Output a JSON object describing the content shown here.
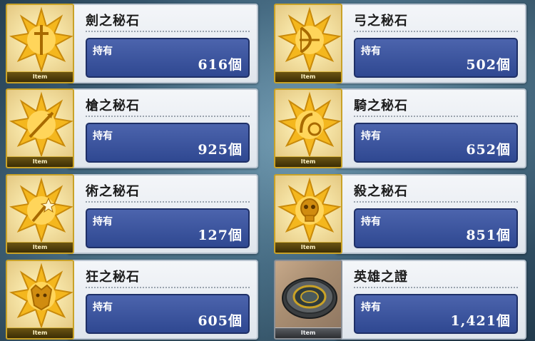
{
  "items": [
    {
      "name": "劍之秘石",
      "own_label": "持有",
      "count": "616個",
      "tag": "Item",
      "icon": "saber-star-icon",
      "kind": "star"
    },
    {
      "name": "弓之秘石",
      "own_label": "持有",
      "count": "502個",
      "tag": "Item",
      "icon": "archer-star-icon",
      "kind": "star"
    },
    {
      "name": "槍之秘石",
      "own_label": "持有",
      "count": "925個",
      "tag": "Item",
      "icon": "lancer-star-icon",
      "kind": "star"
    },
    {
      "name": "騎之秘石",
      "own_label": "持有",
      "count": "652個",
      "tag": "Item",
      "icon": "rider-star-icon",
      "kind": "star"
    },
    {
      "name": "術之秘石",
      "own_label": "持有",
      "count": "127個",
      "tag": "Item",
      "icon": "caster-star-icon",
      "kind": "star"
    },
    {
      "name": "殺之秘石",
      "own_label": "持有",
      "count": "851個",
      "tag": "Item",
      "icon": "assassin-star-icon",
      "kind": "star"
    },
    {
      "name": "狂之秘石",
      "own_label": "持有",
      "count": "605個",
      "tag": "Item",
      "icon": "berserker-star-icon",
      "kind": "star"
    },
    {
      "name": "英雄之證",
      "own_label": "持有",
      "count": "1,421個",
      "tag": "Item",
      "icon": "hero-proof-plate-icon",
      "kind": "plate"
    }
  ],
  "colors": {
    "panel_border": "#b9c4d0",
    "own_box": "#3a539c",
    "star_gold": "#f2b51c"
  }
}
